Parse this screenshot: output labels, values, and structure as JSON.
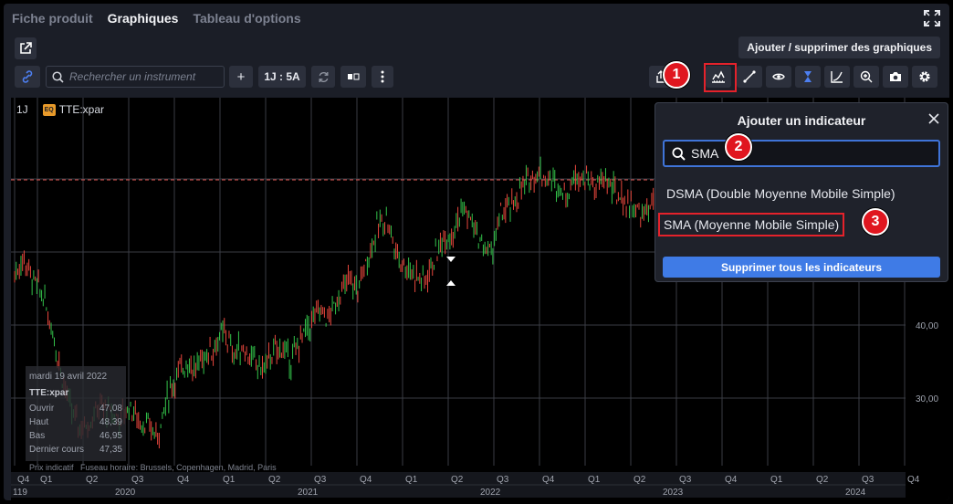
{
  "tabs": [
    {
      "label": "Fiche produit",
      "active": false
    },
    {
      "label": "Graphiques",
      "active": true
    },
    {
      "label": "Tableau d'options",
      "active": false
    }
  ],
  "add_graph_label": "Ajouter / supprimer des graphiques",
  "toolbar": {
    "search_placeholder": "Rechercher un instrument",
    "plus_label": "+",
    "period_label": "1J : 5A"
  },
  "chart": {
    "interval": "1J",
    "badge": "EQ",
    "symbol": "TTE:xpar",
    "y_labels": [
      "40,00",
      "30,00"
    ],
    "footnote_left": "Prix indicatif",
    "footnote": "Fuseau horaire: Brussels, Copenhagen, Madrid, Paris",
    "infobox": {
      "date": "mardi 19 avril 2022",
      "symbol": "TTE:xpar",
      "rows": [
        {
          "label": "Ouvrir",
          "value": "47,08"
        },
        {
          "label": "Haut",
          "value": "48,39"
        },
        {
          "label": "Bas",
          "value": "46,95"
        },
        {
          "label": "Dernier cours",
          "value": "47,35"
        }
      ]
    },
    "x_quarters": [
      "Q4",
      "Q1",
      "Q2",
      "Q3",
      "Q4",
      "Q1",
      "Q2",
      "Q3",
      "Q4",
      "Q1",
      "Q2",
      "Q3",
      "Q4",
      "Q1",
      "Q2",
      "Q3",
      "Q4",
      "Q1",
      "Q2",
      "Q3",
      "Q4"
    ],
    "x_years": [
      "119",
      "2020",
      "2021",
      "2022",
      "2023",
      "2024"
    ]
  },
  "chart_data": {
    "type": "candlestick",
    "symbol": "TTE:xpar",
    "x_range": [
      "2019-Q4",
      "2024-Q4"
    ],
    "y_axis_labels": [
      40,
      30
    ],
    "series": [
      {
        "values": [
          47,
          49,
          46,
          44,
          39,
          33,
          28,
          26,
          27,
          29,
          28,
          27,
          29,
          27,
          26,
          25,
          30,
          33,
          35,
          34,
          36,
          37,
          39,
          36,
          37,
          35,
          34,
          36,
          37,
          35,
          38,
          40,
          42,
          41,
          44,
          46,
          45,
          49,
          53,
          55,
          50,
          48,
          47,
          46,
          49,
          52,
          53,
          56,
          54,
          51,
          50,
          55,
          56,
          58,
          60,
          61,
          60,
          59,
          58,
          61,
          60,
          59,
          60,
          58,
          57,
          56,
          55,
          57,
          56,
          54,
          53
        ]
      }
    ]
  },
  "panel": {
    "title": "Ajouter un indicateur",
    "search_value": "SMA",
    "items": [
      "DSMA (Double Moyenne Mobile Simple)",
      "SMA (Moyenne Mobile Simple)"
    ],
    "delete_label": "Supprimer tous les indicateurs"
  },
  "markers": [
    "1",
    "2",
    "3"
  ]
}
